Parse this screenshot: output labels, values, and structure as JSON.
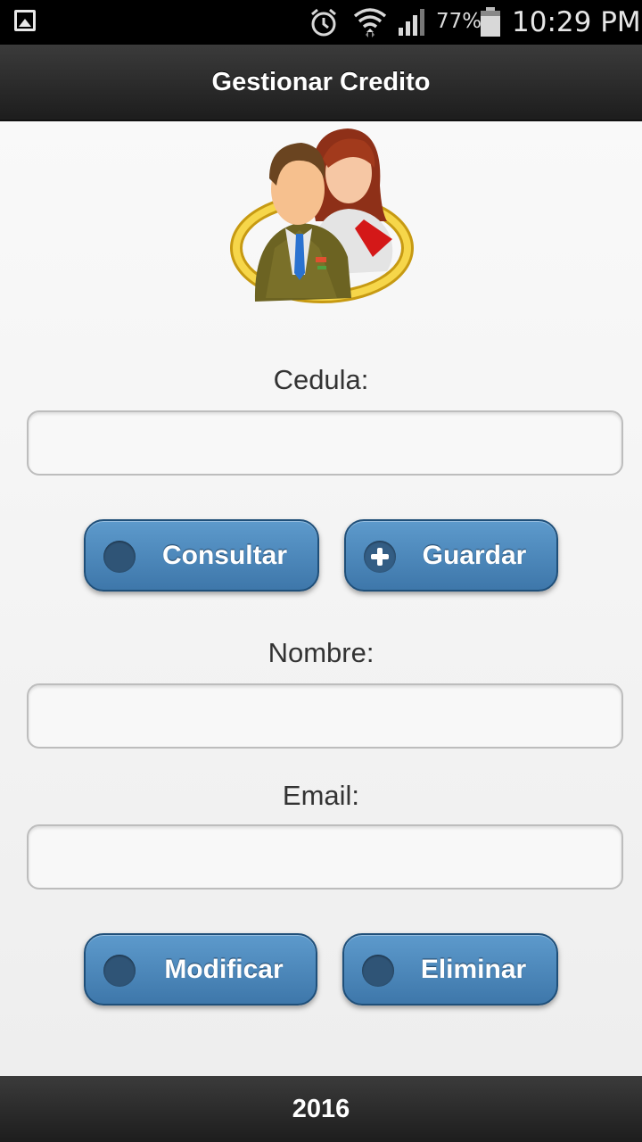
{
  "status_bar": {
    "battery_percent": "77%",
    "time": "10:29 PM",
    "icons": [
      "gallery-notification-icon",
      "alarm-icon",
      "wifi-icon",
      "signal-icon",
      "battery-icon"
    ]
  },
  "header": {
    "title": "Gestionar Credito"
  },
  "form": {
    "cedula_label": "Cedula:",
    "cedula_value": "",
    "nombre_label": "Nombre:",
    "nombre_value": "",
    "email_label": "Email:",
    "email_value": ""
  },
  "buttons": {
    "consultar": "Consultar",
    "guardar": "Guardar",
    "modificar": "Modificar",
    "eliminar": "Eliminar"
  },
  "footer": {
    "text": "2016"
  },
  "colors": {
    "button_gradient_top": "#5d9acc",
    "button_gradient_bottom": "#3e77aa",
    "bar_dark": "#1d1d1d"
  }
}
